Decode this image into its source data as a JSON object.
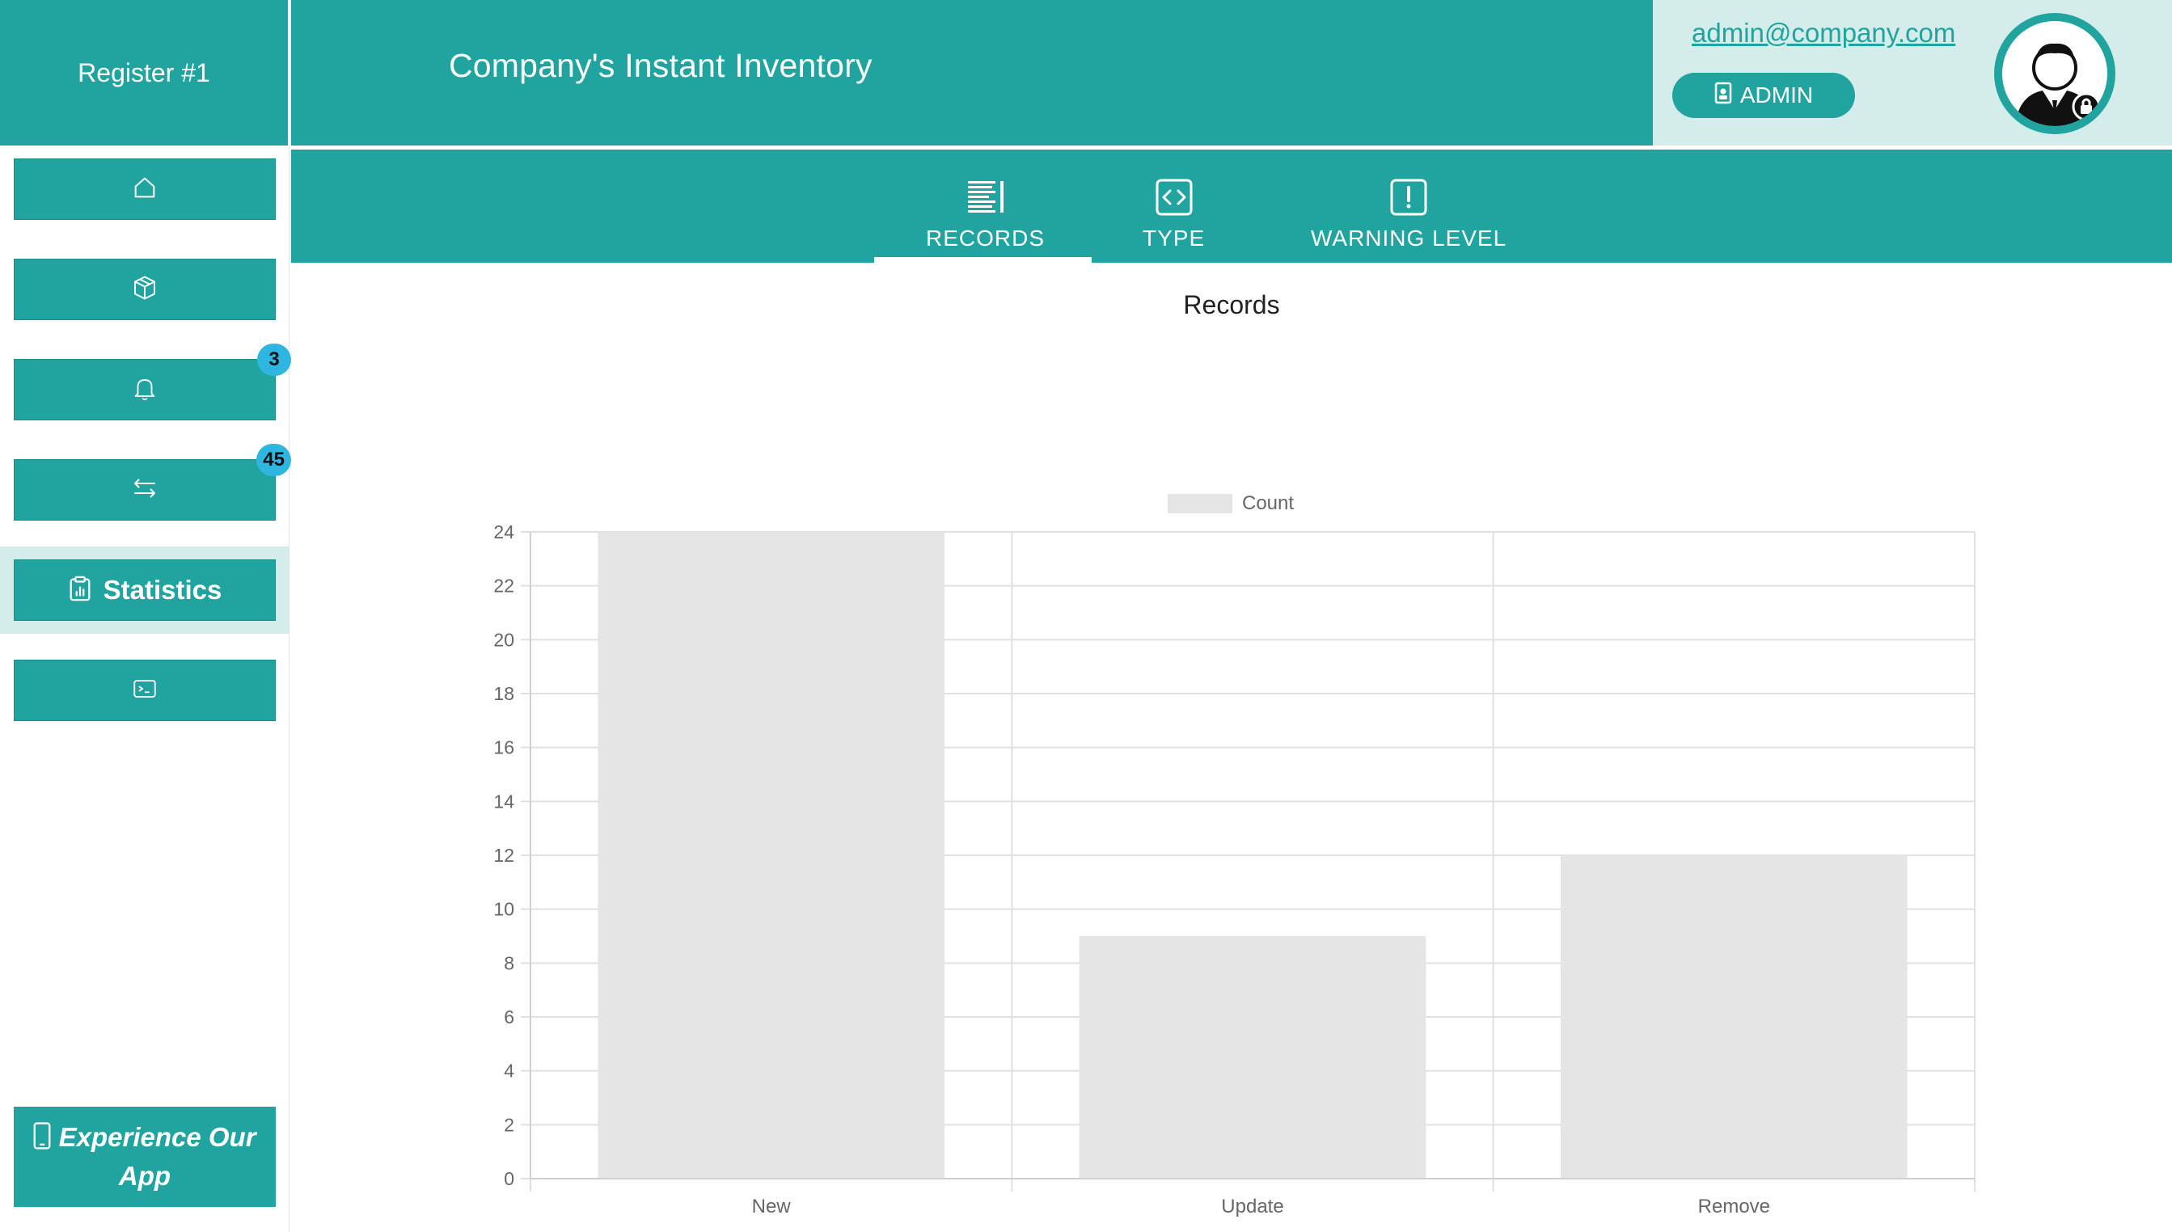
{
  "register": "Register #1",
  "app_title": "Company's Instant Inventory",
  "user": {
    "email": "admin@company.com",
    "role": "ADMIN"
  },
  "sidebar": {
    "items": [
      {
        "icon": "home-icon"
      },
      {
        "icon": "package-icon"
      },
      {
        "icon": "bell-icon",
        "badge": "3"
      },
      {
        "icon": "transfer-icon",
        "badge": "45"
      },
      {
        "icon": "clipboard-chart-icon",
        "label": "Statistics",
        "active": true
      },
      {
        "icon": "terminal-icon"
      }
    ],
    "promo": "Experience Our App"
  },
  "tabs": [
    {
      "label": "RECORDS",
      "icon": "list-icon",
      "active": true
    },
    {
      "label": "TYPE",
      "icon": "code-icon"
    },
    {
      "label": "WARNING LEVEL",
      "icon": "exclamation-icon"
    }
  ],
  "colors": {
    "teal": "#21a49f",
    "light_teal": "#d4edea",
    "badge": "#2fb6e0",
    "bar": "#e5e5e5"
  },
  "chart_data": {
    "type": "bar",
    "title": "Records",
    "categories": [
      "New",
      "Update",
      "Remove"
    ],
    "series": [
      {
        "name": "Count",
        "values": [
          24,
          9,
          12
        ]
      }
    ],
    "ylim": [
      0,
      24
    ],
    "yticks": [
      "0",
      "2",
      "4",
      "6",
      "8",
      "10",
      "12",
      "14",
      "16",
      "18",
      "20",
      "22",
      "24"
    ],
    "grid": true,
    "legend": "top"
  }
}
